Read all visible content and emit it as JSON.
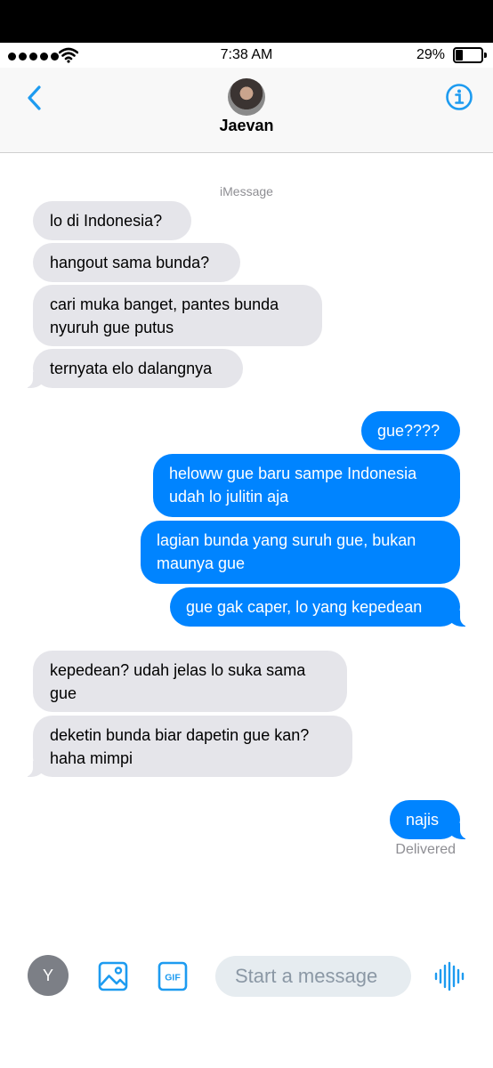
{
  "status_bar": {
    "time": "7:38 AM",
    "battery_percent": "29%",
    "battery_level": 0.29
  },
  "header": {
    "contact_name": "Jaevan",
    "back_icon": "chevron-left-icon",
    "info_icon": "info-icon"
  },
  "conversation": {
    "service_label": "iMessage",
    "messages": [
      {
        "from": "them",
        "text": "lo di Indonesia?"
      },
      {
        "from": "them",
        "text": "hangout sama bunda?"
      },
      {
        "from": "them",
        "text": "cari muka banget, pantes bunda\nnyuruh gue putus"
      },
      {
        "from": "them",
        "text": "ternyata elo dalangnya"
      },
      {
        "from": "me",
        "text": "gue????"
      },
      {
        "from": "me",
        "text": "heloww gue baru sampe Indonesia\nudah lo julitin aja"
      },
      {
        "from": "me",
        "text": "lagian bunda yang suruh gue, bukan\nmaunya gue"
      },
      {
        "from": "me",
        "text": "gue gak caper, lo yang kepedean"
      },
      {
        "from": "them",
        "text": "kepedean? udah jelas lo suka sama\ngue"
      },
      {
        "from": "them",
        "text": "deketin bunda biar dapetin gue kan?\nhaha mimpi"
      },
      {
        "from": "me",
        "text": "najis"
      }
    ],
    "delivery_status": "Delivered"
  },
  "composer": {
    "user_initial": "Y",
    "placeholder": "Start a message",
    "icons": [
      "image-icon",
      "gif-icon",
      "voice-waveform-icon"
    ],
    "gif_label": "GIF"
  },
  "colors": {
    "accent": "#1d9bf0",
    "outgoing_bubble": "#0084ff",
    "incoming_bubble": "#e5e5ea"
  }
}
